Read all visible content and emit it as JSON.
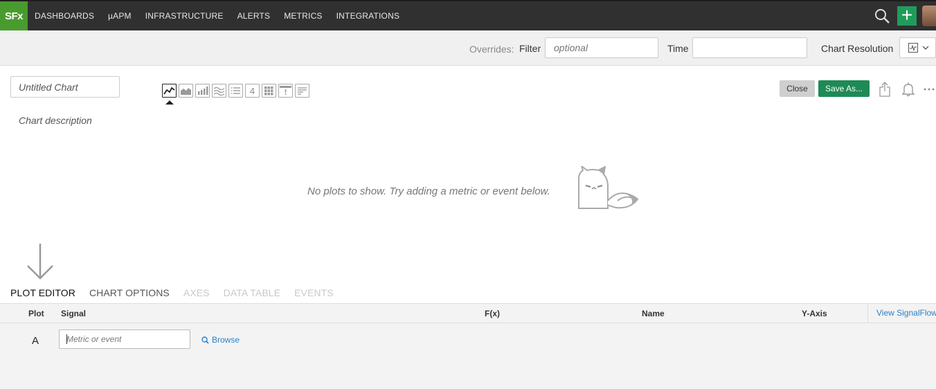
{
  "nav": {
    "logo": "SFx",
    "items": [
      "DASHBOARDS",
      "µAPM",
      "INFRASTRUCTURE",
      "ALERTS",
      "METRICS",
      "INTEGRATIONS"
    ],
    "add_label": "+"
  },
  "overrides": {
    "label": "Overrides:",
    "filter_label": "Filter",
    "filter_placeholder": "optional",
    "time_label": "Time",
    "time_value": "",
    "resolution_label": "Chart Resolution"
  },
  "chart": {
    "title_placeholder": "Untitled Chart",
    "description_placeholder": "Chart description",
    "types": [
      "line-chart-icon",
      "area-chart-icon",
      "column-chart-icon",
      "histogram-icon",
      "list-icon",
      "single-value-icon",
      "heatmap-icon",
      "event-feed-icon",
      "text-note-icon"
    ],
    "single_value_glyph": "4",
    "close_label": "Close",
    "save_label": "Save As...",
    "empty_message": "No plots to show. Try adding a metric or event below."
  },
  "tabs": [
    {
      "label": "PLOT EDITOR",
      "state": "active"
    },
    {
      "label": "CHART OPTIONS",
      "state": "normal"
    },
    {
      "label": "AXES",
      "state": "disabled"
    },
    {
      "label": "DATA TABLE",
      "state": "disabled"
    },
    {
      "label": "EVENTS",
      "state": "disabled"
    }
  ],
  "plot_table": {
    "headers": {
      "plot": "Plot",
      "signal": "Signal",
      "fx": "F(x)",
      "name": "Name",
      "yaxis": "Y-Axis"
    },
    "view_signalflow": "View SignalFlow",
    "rows": [
      {
        "letter": "A",
        "placeholder": "Metric or event",
        "browse": "Browse"
      }
    ]
  },
  "colors": {
    "nav_bg": "#303030",
    "logo_green": "#4a9b2e",
    "save_green": "#1e8a55",
    "link_blue": "#2a7fc9"
  }
}
